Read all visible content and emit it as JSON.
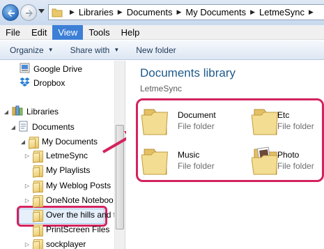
{
  "address": {
    "crumbs": [
      "Libraries",
      "Documents",
      "My Documents",
      "LetmeSync"
    ]
  },
  "menu": {
    "items": [
      {
        "label": "File",
        "active": false
      },
      {
        "label": "Edit",
        "active": false
      },
      {
        "label": "View",
        "active": true
      },
      {
        "label": "Tools",
        "active": false
      },
      {
        "label": "Help",
        "active": false
      }
    ]
  },
  "toolbar": {
    "organize": "Organize",
    "share_with": "Share with",
    "new_folder": "New folder"
  },
  "nav": {
    "items": [
      {
        "label": "Google Drive",
        "icon": "google-drive-icon"
      },
      {
        "label": "Dropbox",
        "icon": "dropbox-icon"
      },
      {
        "label": "Libraries",
        "icon": "libraries-icon"
      },
      {
        "label": "Documents",
        "icon": "documents-icon"
      },
      {
        "label": "My Documents",
        "icon": "folder-icon"
      },
      {
        "label": "LetmeSync",
        "icon": "folder-icon"
      },
      {
        "label": "My Playlists",
        "icon": "folder-icon"
      },
      {
        "label": "My Weblog Posts",
        "icon": "folder-icon"
      },
      {
        "label": "OneNote Noteboo",
        "icon": "folder-icon"
      },
      {
        "label": "Over the hills and t",
        "icon": "folder-icon"
      },
      {
        "label": "PrintScreen Files",
        "icon": "folder-icon"
      },
      {
        "label": "sockplayer",
        "icon": "folder-icon"
      }
    ]
  },
  "content": {
    "title": "Documents library",
    "subtitle": "LetmeSync",
    "files": [
      {
        "name": "Document",
        "type": "File folder"
      },
      {
        "name": "Etc",
        "type": "File folder"
      },
      {
        "name": "Music",
        "type": "File folder"
      },
      {
        "name": "Photo",
        "type": "File folder"
      }
    ]
  },
  "colors": {
    "accent": "#3c7fd6",
    "highlight": "#d3235e",
    "title": "#1e5a8c"
  }
}
